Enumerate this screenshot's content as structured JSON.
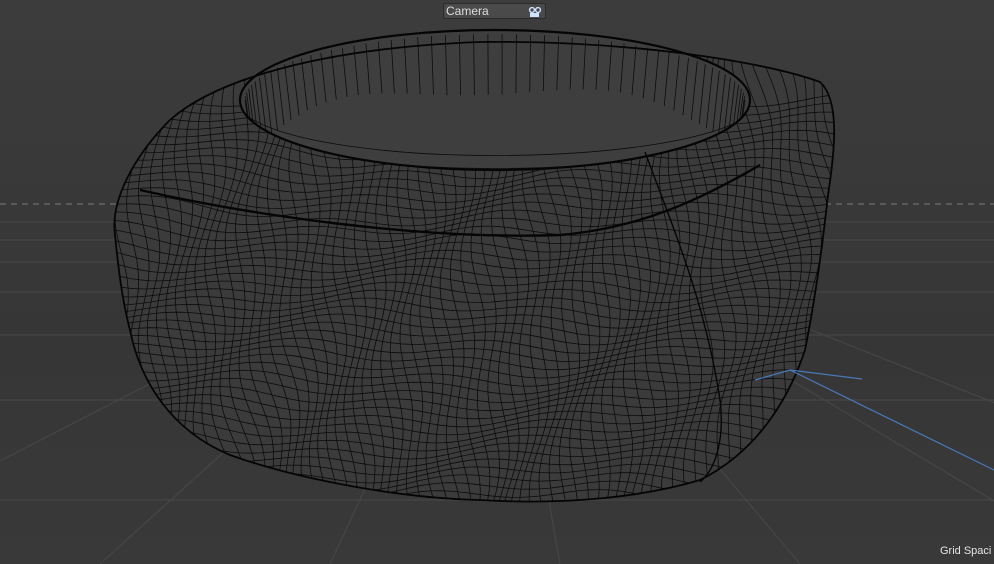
{
  "viewport": {
    "camera_label": "Camera",
    "camera_icon": "camera-icon",
    "grid_spacing_label": "Grid Spaci",
    "background_color": "#3a3a3a",
    "mesh_line_color": "#0c0c0c",
    "axis_color": "#4a78b8"
  }
}
